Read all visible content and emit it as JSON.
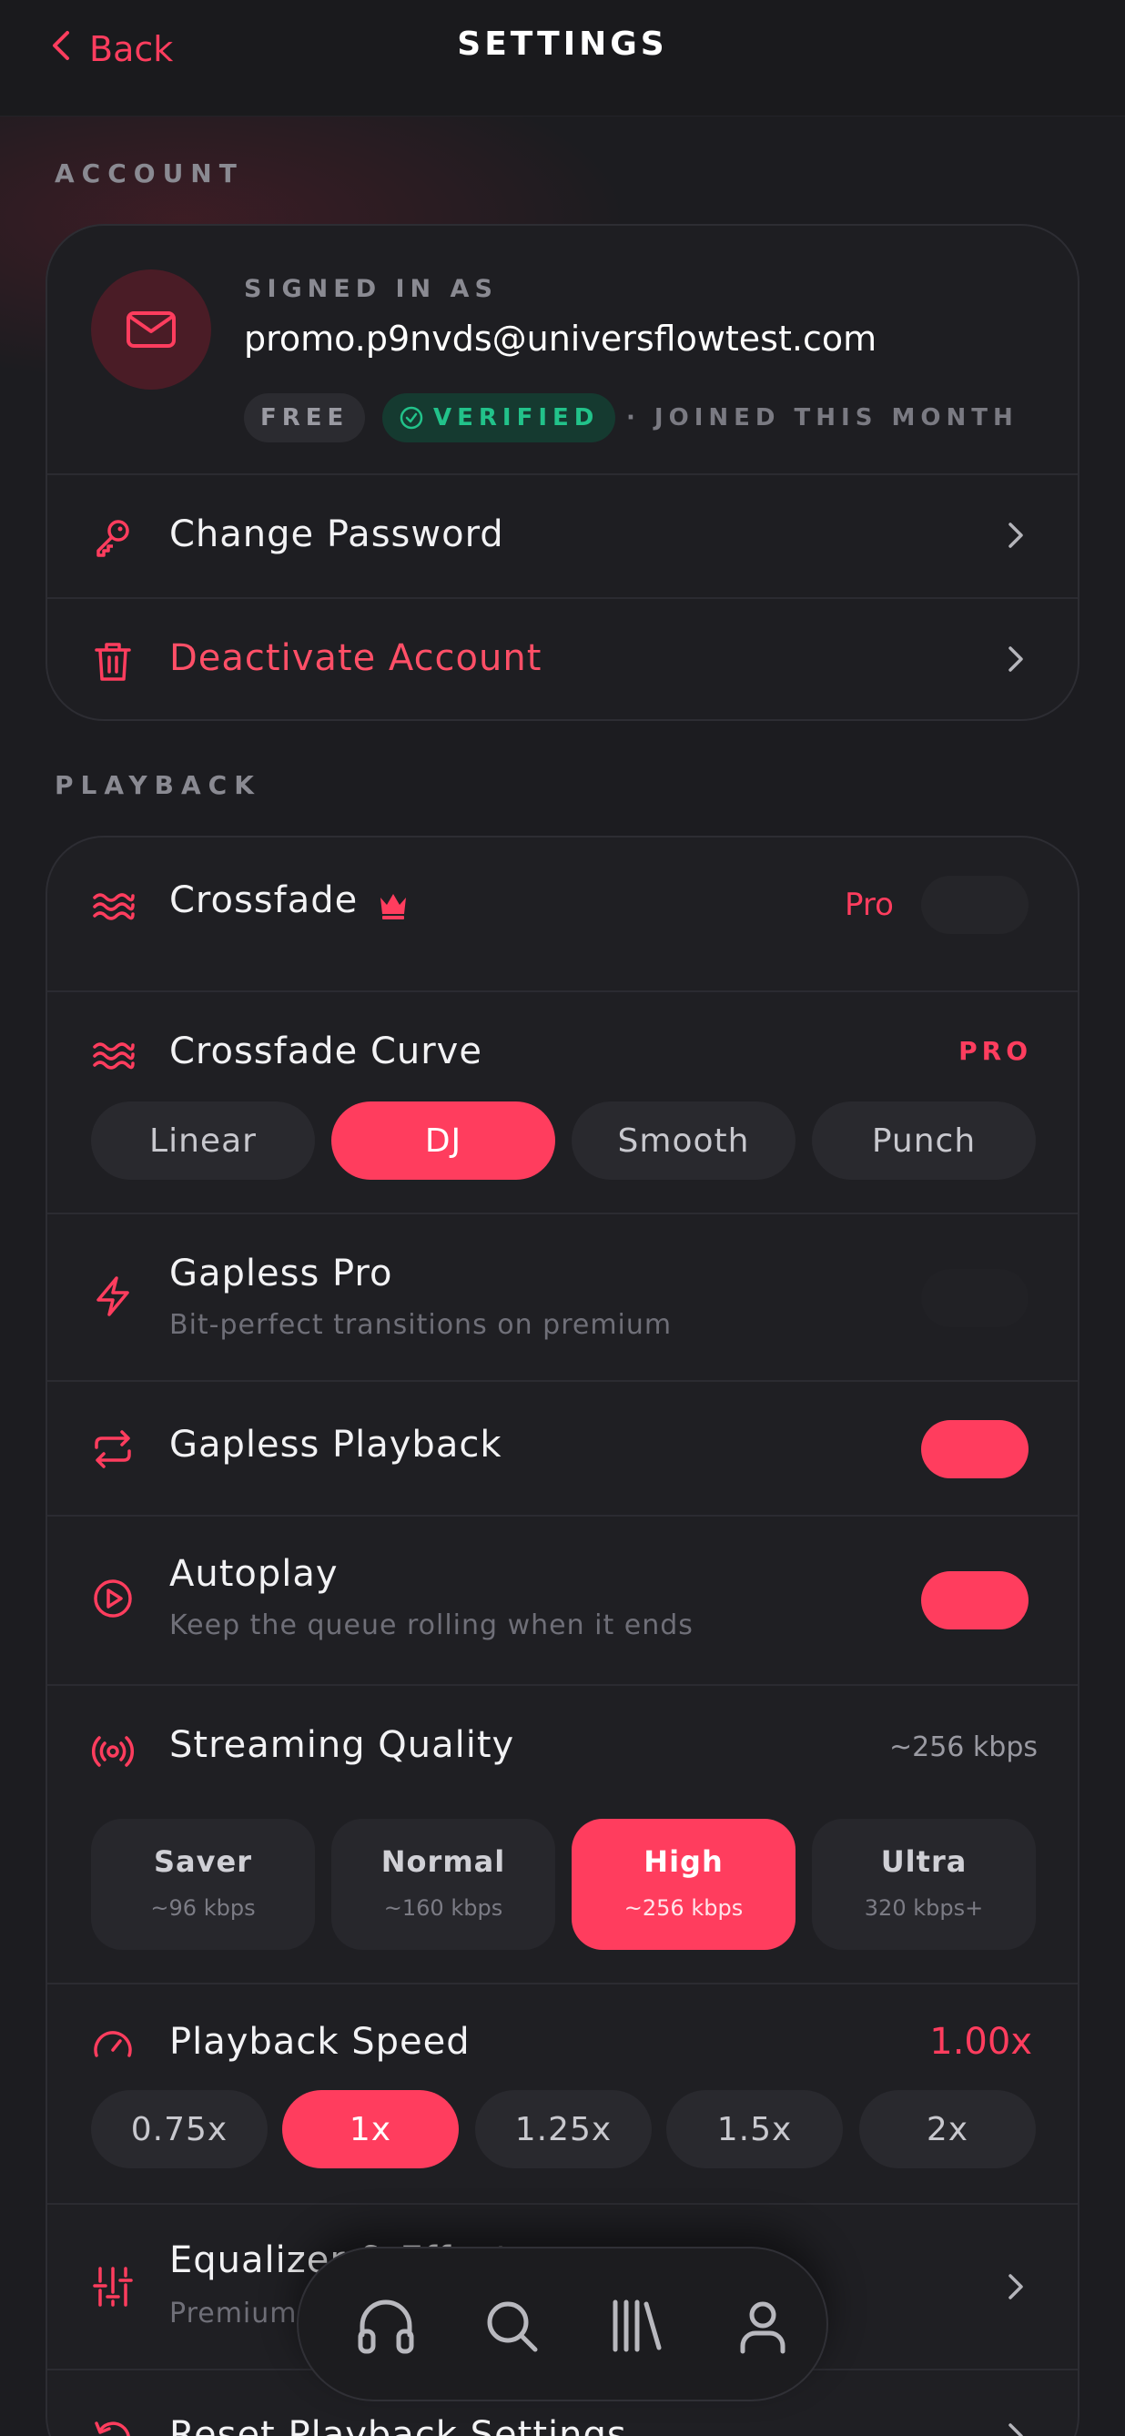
{
  "header": {
    "back_label": "Back",
    "title": "SETTINGS"
  },
  "account": {
    "section_label": "ACCOUNT",
    "signed_in_label": "SIGNED IN AS",
    "email": "promo.p9nvds@universflowtest.com",
    "plan_badge": "FREE",
    "verified_badge": "VERIFIED",
    "joined_text": "· JOINED THIS MONTH",
    "change_password": "Change Password",
    "deactivate": "Deactivate Account"
  },
  "playback": {
    "section_label": "PLAYBACK",
    "crossfade": {
      "label": "Crossfade",
      "badge": "Pro",
      "enabled": false
    },
    "crossfade_curve": {
      "label": "Crossfade Curve",
      "badge": "PRO",
      "options": [
        "Linear",
        "DJ",
        "Smooth",
        "Punch"
      ],
      "selected": "DJ"
    },
    "gapless_pro": {
      "label": "Gapless Pro",
      "subtitle": "Bit-perfect transitions on premium",
      "enabled": false
    },
    "gapless_playback": {
      "label": "Gapless Playback",
      "enabled": true
    },
    "autoplay": {
      "label": "Autoplay",
      "subtitle": "Keep the queue rolling when it ends",
      "enabled": true
    },
    "streaming_quality": {
      "label": "Streaming Quality",
      "value": "~256 kbps",
      "options": [
        {
          "name": "Saver",
          "sub": "~96 kbps"
        },
        {
          "name": "Normal",
          "sub": "~160 kbps"
        },
        {
          "name": "High",
          "sub": "~256 kbps"
        },
        {
          "name": "Ultra",
          "sub": "320 kbps+"
        }
      ],
      "selected": "High"
    },
    "playback_speed": {
      "label": "Playback Speed",
      "value": "1.00x",
      "options": [
        "0.75x",
        "1x",
        "1.25x",
        "1.5x",
        "2x"
      ],
      "selected": "1x"
    },
    "equalizer": {
      "label": "Equalizer & Effects",
      "subtitle": "Premium s..."
    },
    "reset": {
      "label": "Reset Playback Settings"
    }
  },
  "bottom_nav": {
    "items": [
      "headphones-icon",
      "search-icon",
      "library-icon",
      "profile-icon"
    ]
  },
  "colors": {
    "accent": "#ff3d5e",
    "background": "#1c1c20",
    "card": "#1f1f23",
    "verified": "#22c28a"
  }
}
